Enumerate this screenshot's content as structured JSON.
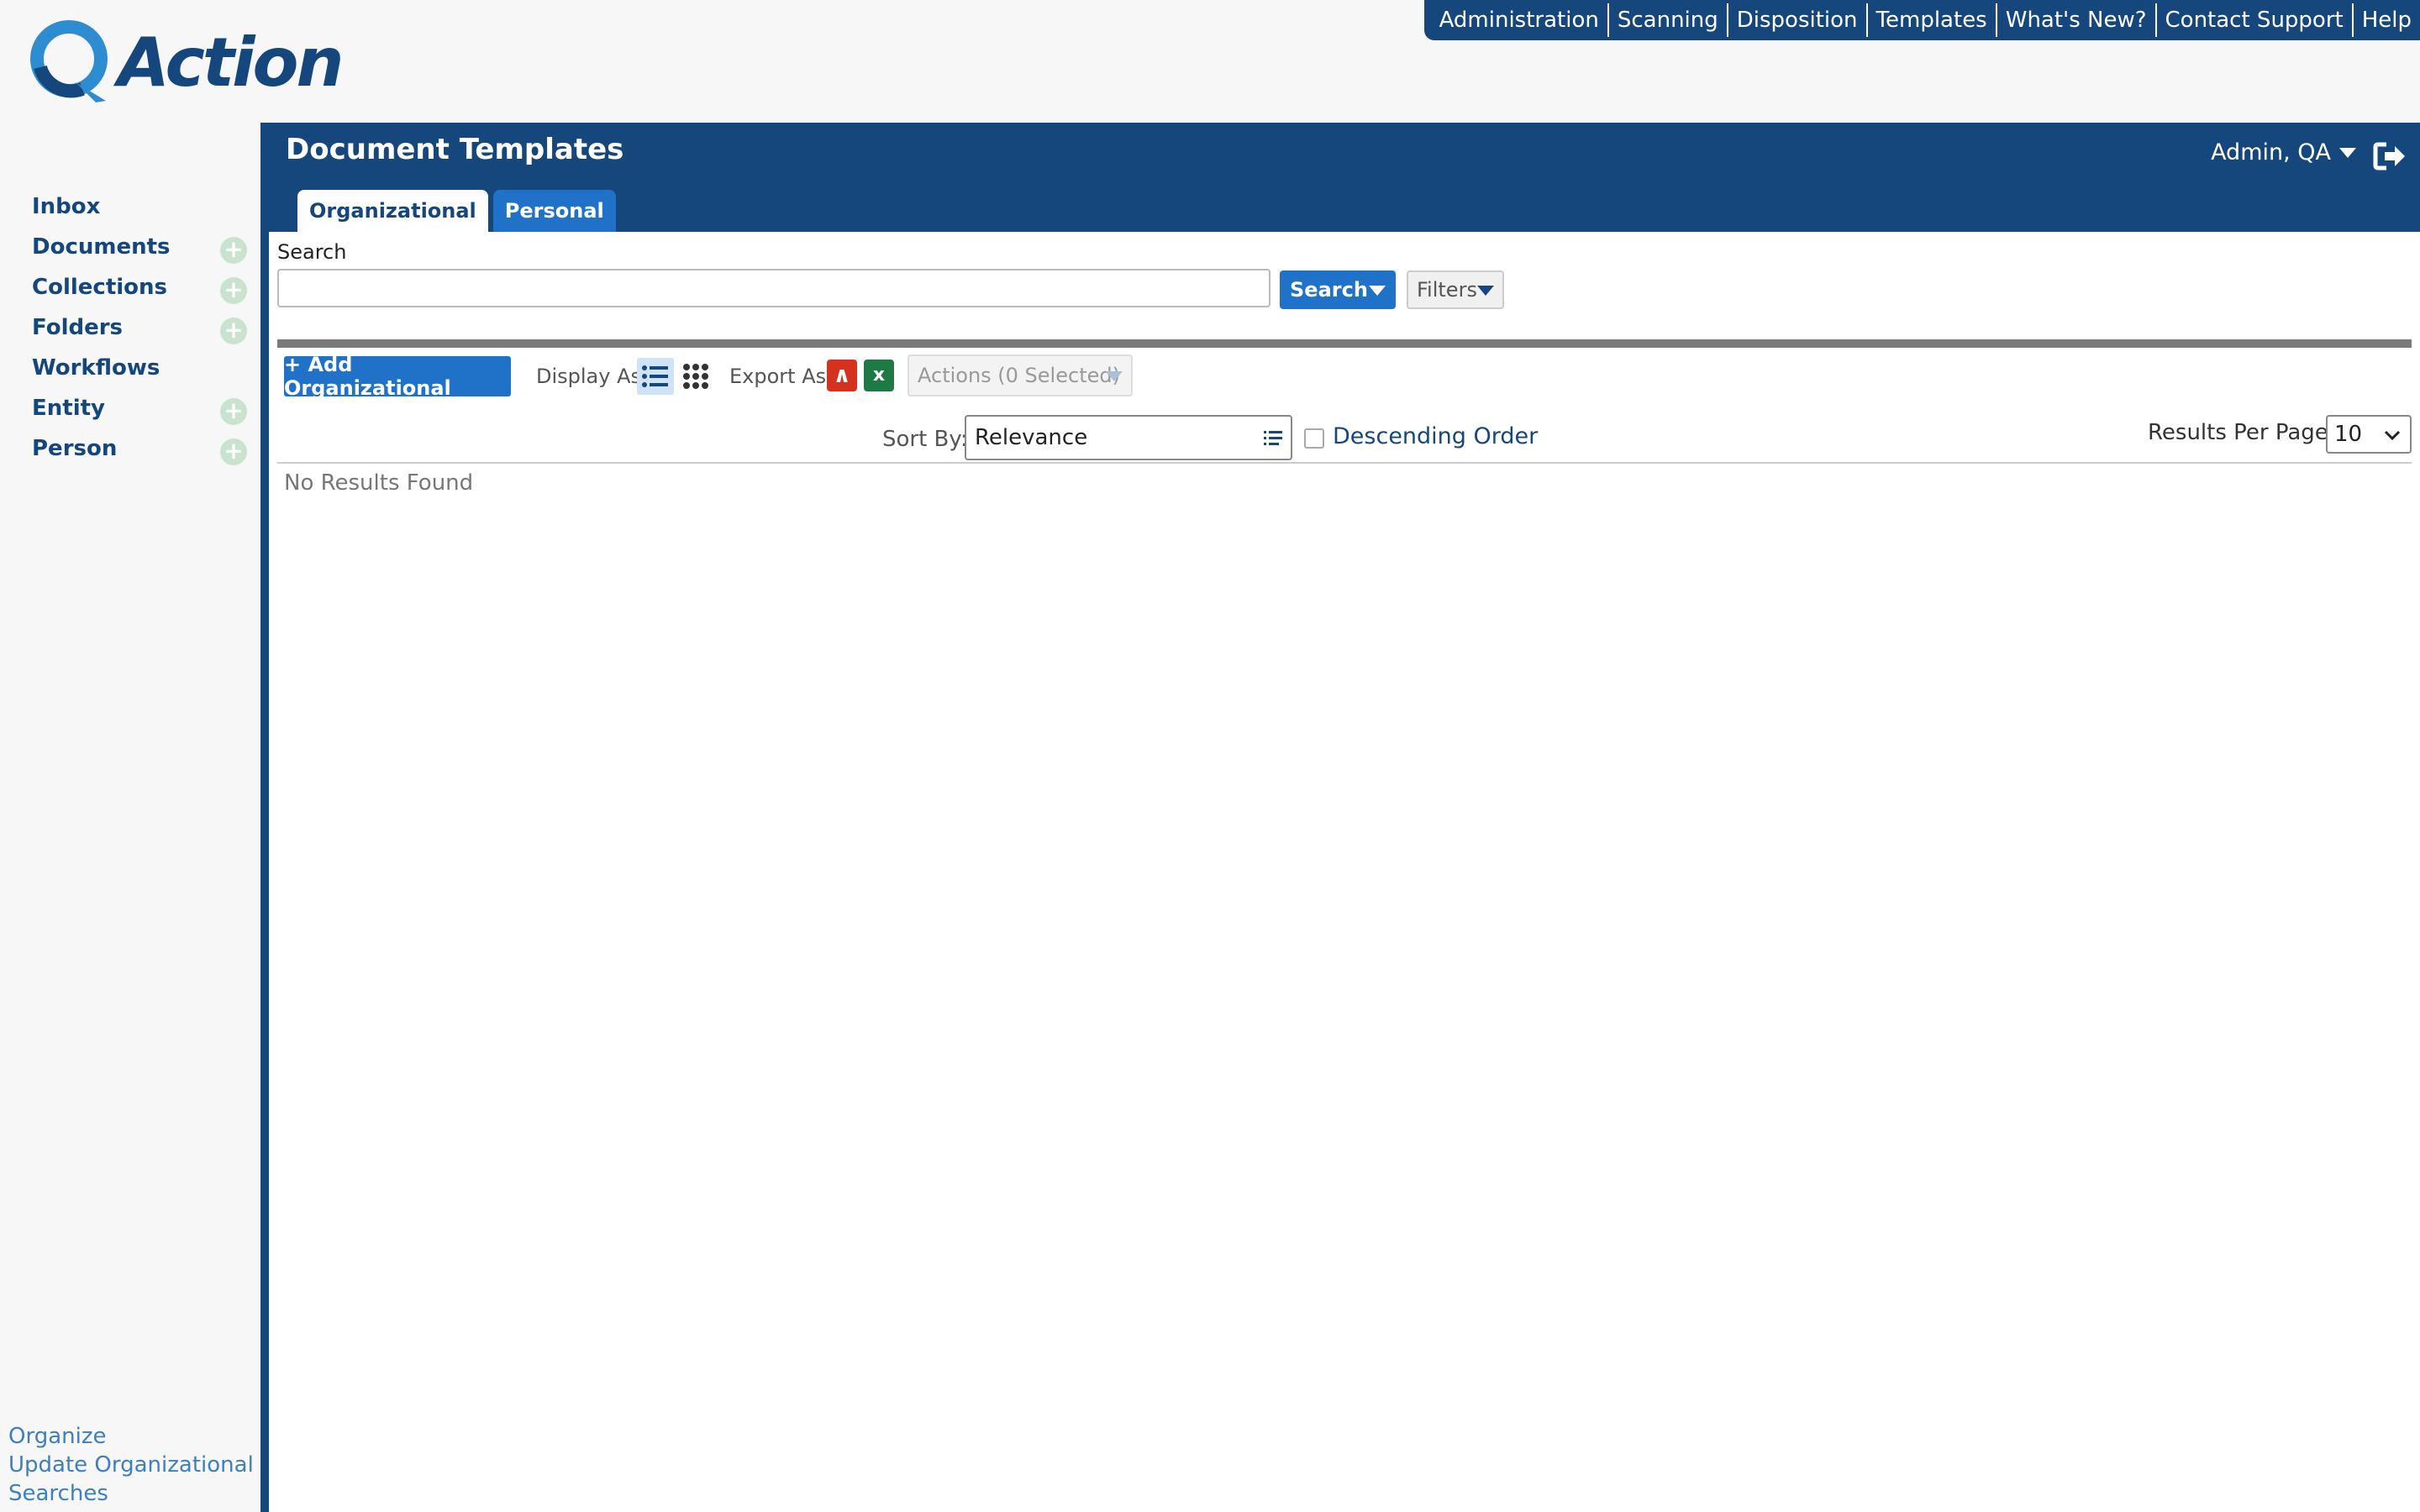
{
  "app": {
    "logo_text": "Action"
  },
  "topnav": [
    "Administration",
    "Scanning",
    "Disposition",
    "Templates",
    "What's New?",
    "Contact Support",
    "Help"
  ],
  "sidebar": {
    "items": [
      {
        "label": "Inbox",
        "has_add": false
      },
      {
        "label": "Documents",
        "has_add": true
      },
      {
        "label": "Collections",
        "has_add": true
      },
      {
        "label": "Folders",
        "has_add": true
      },
      {
        "label": "Workflows",
        "has_add": false
      },
      {
        "label": "Entity",
        "has_add": true
      },
      {
        "label": "Person",
        "has_add": true
      }
    ],
    "bottom_links": [
      "Organize",
      "Update Organizational",
      "Searches"
    ]
  },
  "header": {
    "title": "Document Templates",
    "user": "Admin, QA",
    "tabs": [
      {
        "label": "Organizational",
        "active": true
      },
      {
        "label": "Personal",
        "active": false
      }
    ]
  },
  "search": {
    "label": "Search",
    "value": "",
    "button_label": "Search",
    "filters_label": "Filters"
  },
  "toolbar": {
    "add_label": "+ Add Organizational",
    "display_as": "Display As",
    "export_as": "Export As",
    "actions_label": "Actions (0 Selected)"
  },
  "sort": {
    "label": "Sort By:",
    "value": "Relevance",
    "descending_label": "Descending Order",
    "descending_checked": false,
    "results_per_page_label": "Results Per Page:",
    "results_per_page": "10"
  },
  "results": {
    "empty_text": "No Results Found"
  },
  "colors": {
    "brand": "#15477d",
    "accent": "#1f72c8"
  },
  "icons": {
    "logout": "logout-icon",
    "list_view": "list-view-icon",
    "grid_view": "grid-view-icon",
    "pdf": "pdf-icon",
    "excel": "excel-icon"
  }
}
